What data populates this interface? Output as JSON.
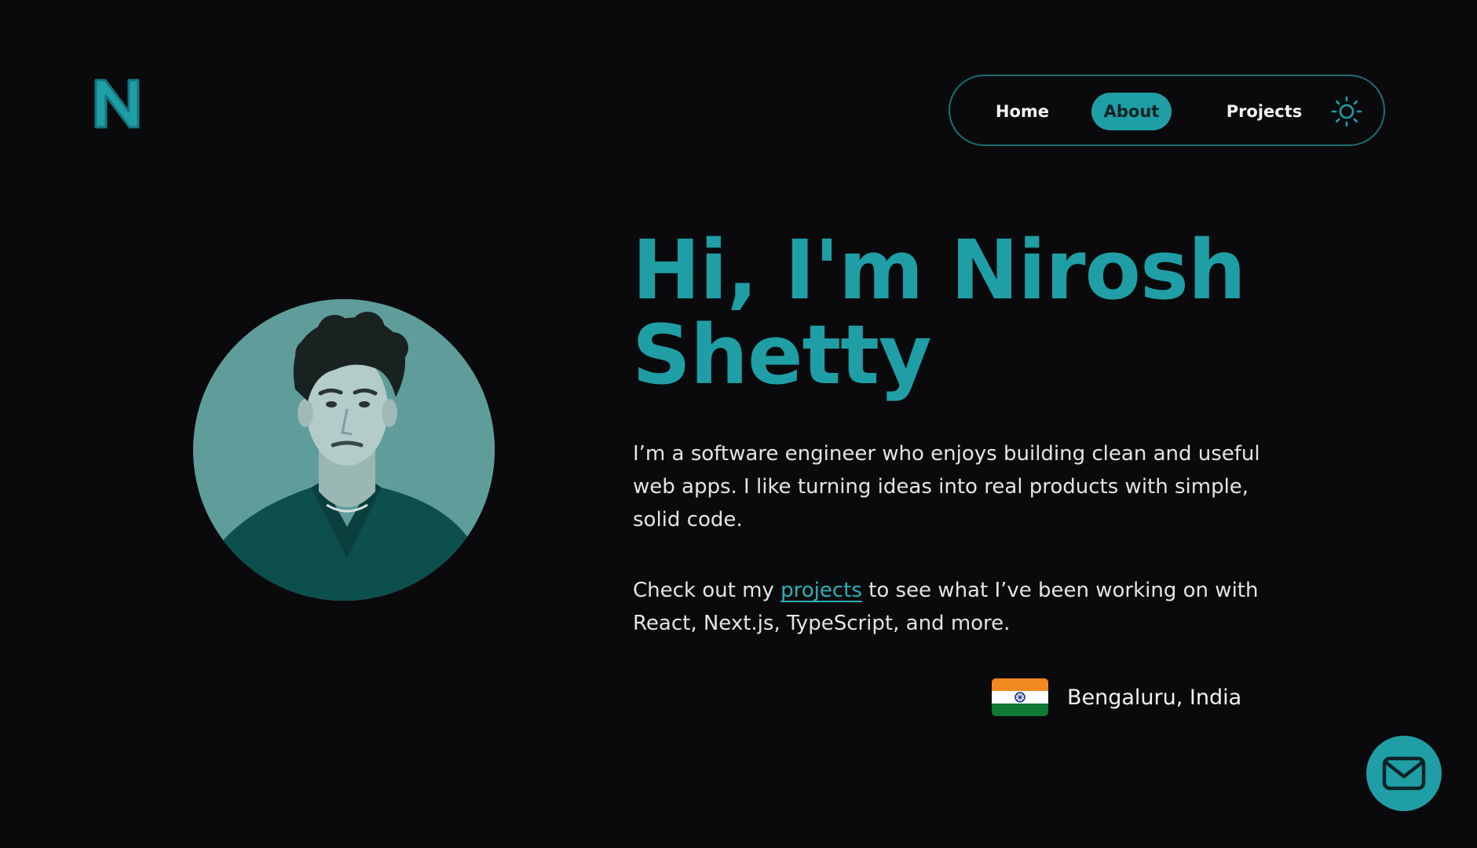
{
  "brand": {
    "logo_letter": "N"
  },
  "nav": {
    "items": [
      {
        "label": "Home"
      },
      {
        "label": "About",
        "active": true
      },
      {
        "label": "Projects"
      }
    ],
    "theme_toggle_icon": "sun-icon"
  },
  "hero": {
    "headline_line1": "Hi, I'm Nirosh",
    "headline_line2": "Shetty",
    "bio": "I’m a software engineer who enjoys building clean and useful web apps. I like turning ideas into real products with simple, solid code.",
    "cta_before": "Check out my ",
    "cta_link": "projects",
    "cta_after": " to see what I’ve been working on with React, Next.js, TypeScript, and more."
  },
  "location": {
    "flag": "india-flag",
    "text": "Bengaluru, India"
  },
  "contact": {
    "icon": "mail-icon"
  },
  "colors": {
    "background": "#0a0a0c",
    "accent": "#1f9ea5",
    "text": "#e4e4e4"
  }
}
